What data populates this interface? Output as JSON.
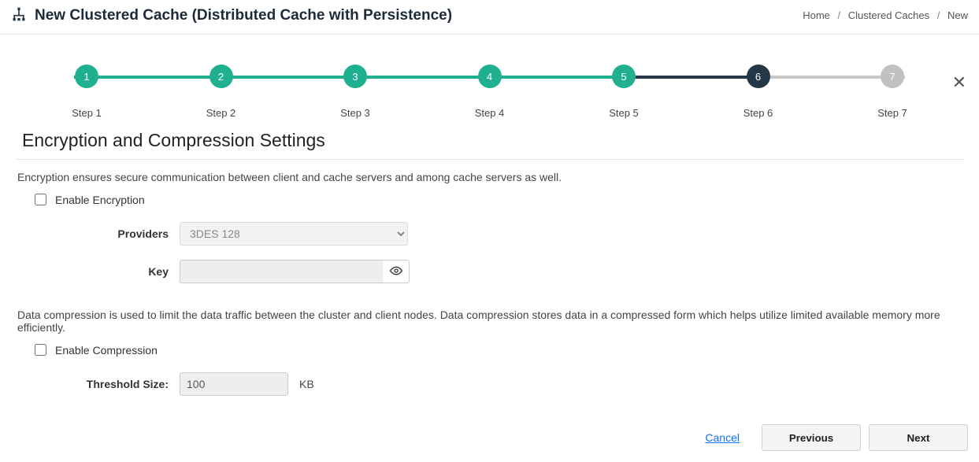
{
  "header": {
    "title": "New Clustered Cache (Distributed Cache with Persistence)",
    "breadcrumb": {
      "home": "Home",
      "parent": "Clustered Caches",
      "current": "New"
    }
  },
  "stepper": {
    "steps": [
      {
        "num": "1",
        "label": "Step 1",
        "state": "done"
      },
      {
        "num": "2",
        "label": "Step 2",
        "state": "done"
      },
      {
        "num": "3",
        "label": "Step 3",
        "state": "done"
      },
      {
        "num": "4",
        "label": "Step 4",
        "state": "done"
      },
      {
        "num": "5",
        "label": "Step 5",
        "state": "done"
      },
      {
        "num": "6",
        "label": "Step 6",
        "state": "current"
      },
      {
        "num": "7",
        "label": "Step 7",
        "state": "future"
      }
    ]
  },
  "section": {
    "title": "Encryption and Compression Settings"
  },
  "encryption": {
    "desc": "Encryption ensures secure communication between client and cache servers and among cache servers as well.",
    "enable_label": "Enable Encryption",
    "providers_label": "Providers",
    "providers_value": "3DES 128",
    "key_label": "Key",
    "key_value": ""
  },
  "compression": {
    "desc": "Data compression is used to limit the data traffic between the cluster and client nodes. Data compression stores data in a compressed form which helps utilize limited available memory more efficiently.",
    "enable_label": "Enable Compression",
    "threshold_label": "Threshold Size:",
    "threshold_value": "100",
    "threshold_unit": "KB"
  },
  "footer": {
    "cancel": "Cancel",
    "previous": "Previous",
    "next": "Next"
  }
}
